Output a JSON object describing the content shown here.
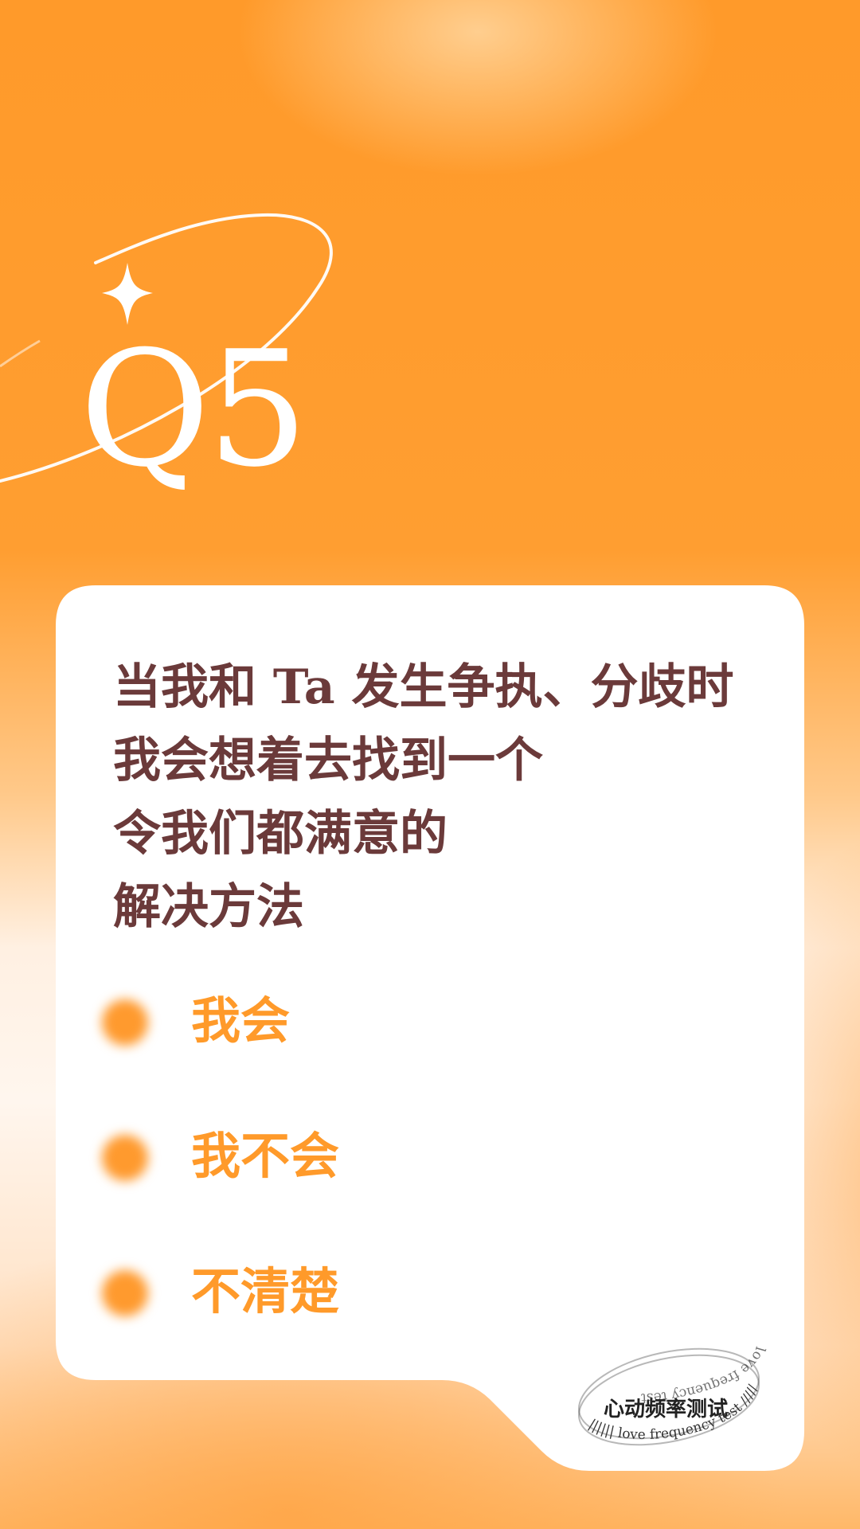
{
  "question_number": "Q5",
  "question_lines": [
    "当我和 Ta 发生争执、分歧时",
    "我会想着去找到一个",
    "令我们都满意的",
    "解决方法"
  ],
  "options": [
    {
      "label": "我会"
    },
    {
      "label": "我不会"
    },
    {
      "label": "不清楚"
    }
  ],
  "stamp": {
    "title_cn": "心动频率测试",
    "subtitle_en": "love frequency test"
  },
  "colors": {
    "background_orange": "#ff9a2a",
    "question_text": "#6b3a3a",
    "option_text": "#ff9a2a",
    "card": "#ffffff"
  },
  "icons": {
    "sparkle": "four-point-star-icon",
    "option_marker": "blurred-orange-dot-icon"
  }
}
